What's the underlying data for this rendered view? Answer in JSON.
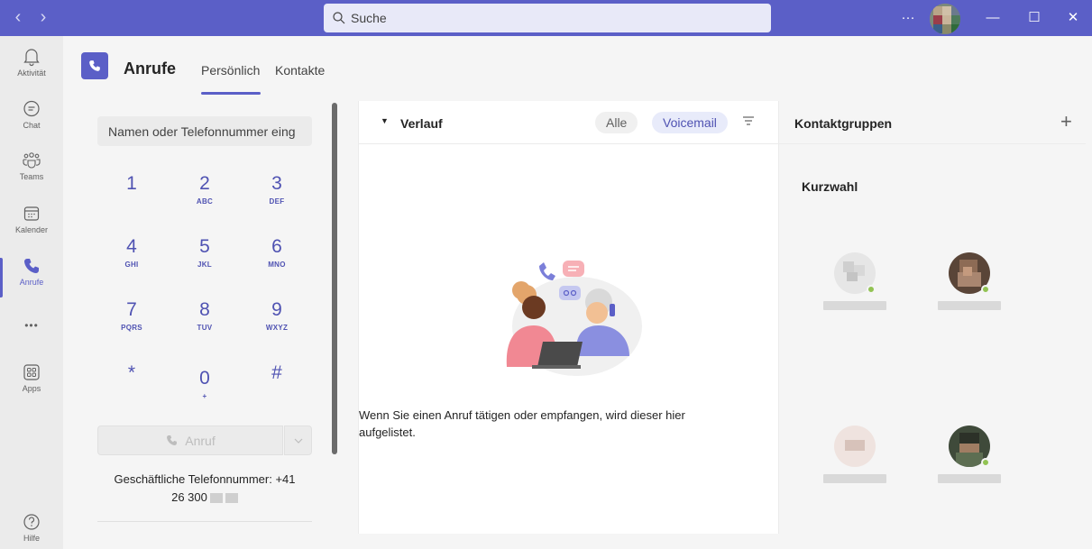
{
  "titlebar": {
    "search_placeholder": "Suche",
    "back_icon": "‹",
    "forward_icon": "›",
    "more": "···",
    "minimize": "—",
    "maximize": "☐",
    "close": "✕"
  },
  "rail": {
    "items": [
      {
        "label": "Aktivität"
      },
      {
        "label": "Chat"
      },
      {
        "label": "Teams"
      },
      {
        "label": "Kalender"
      },
      {
        "label": "Anrufe"
      },
      {
        "label": "•••"
      },
      {
        "label": "Apps"
      },
      {
        "label": "Hilfe"
      }
    ],
    "active": "Anrufe"
  },
  "header": {
    "title": "Anrufe",
    "tabs": [
      {
        "label": "Persönlich",
        "active": true
      },
      {
        "label": "Kontakte",
        "active": false
      }
    ]
  },
  "dialer": {
    "input_placeholder": "Namen oder Telefonnummer eing",
    "keys": [
      {
        "digit": "1",
        "letters": ""
      },
      {
        "digit": "2",
        "letters": "ABC"
      },
      {
        "digit": "3",
        "letters": "DEF"
      },
      {
        "digit": "4",
        "letters": "GHI"
      },
      {
        "digit": "5",
        "letters": "JKL"
      },
      {
        "digit": "6",
        "letters": "MNO"
      },
      {
        "digit": "7",
        "letters": "PQRS"
      },
      {
        "digit": "8",
        "letters": "TUV"
      },
      {
        "digit": "9",
        "letters": "WXYZ"
      },
      {
        "digit": "*",
        "letters": ""
      },
      {
        "digit": "0",
        "letters": "+"
      },
      {
        "digit": "#",
        "letters": ""
      }
    ],
    "call_label": "Anruf",
    "phone_line1": "Geschäftliche Telefonnummer: +41",
    "phone_line2": "26 300"
  },
  "history": {
    "title": "Verlauf",
    "filters": [
      {
        "label": "Alle",
        "active": false
      },
      {
        "label": "Voicemail",
        "active": true
      }
    ],
    "empty_line1": "Wenn Sie einen Anruf tätigen oder empfangen, wird dieser hier",
    "empty_line2": "aufgelistet."
  },
  "contacts": {
    "title": "Kontaktgruppen",
    "add_label": "+",
    "section": "Kurzwahl"
  },
  "colors": {
    "accent": "#5b5fc7",
    "accent_dark": "#4f52b2",
    "presence_available": "#92c353"
  }
}
